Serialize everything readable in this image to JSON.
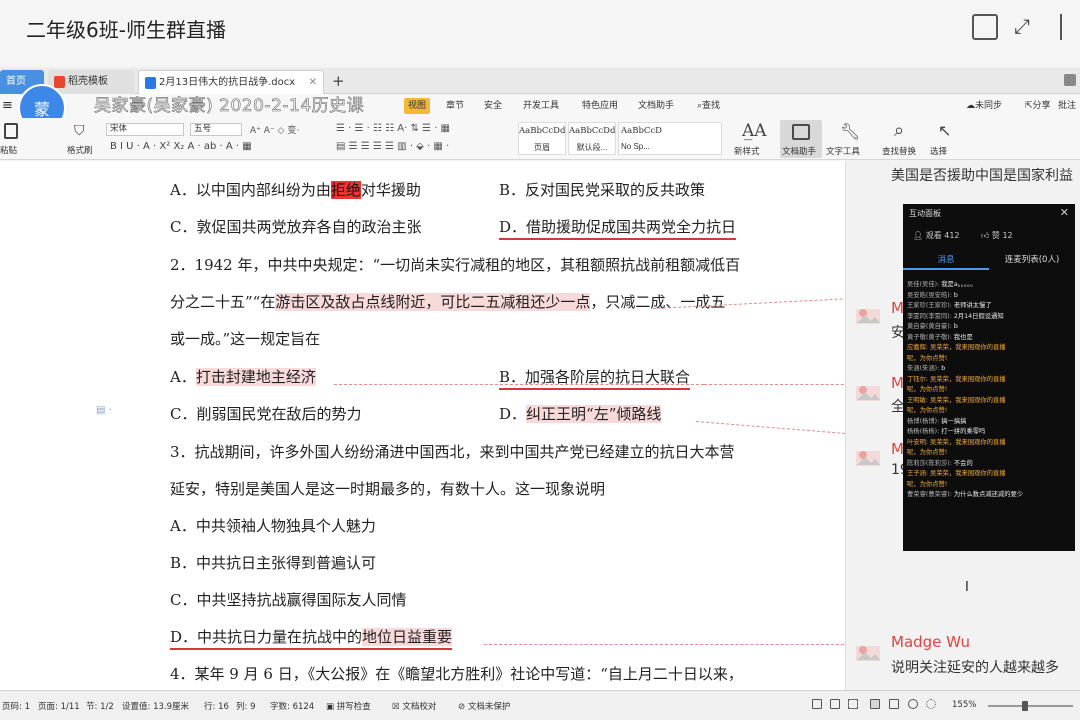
{
  "live": {
    "title": "二年级6班-师生群直播",
    "streamer_line": "吴家豪(吴家豪) 2020-2-14历史课"
  },
  "avatar": {
    "label": "蒙"
  },
  "tabs": [
    {
      "label": "首页"
    },
    {
      "label": "稻壳模板",
      "icon_color": "#e8462d"
    },
    {
      "label": "2月13日伟大的抗日战争.docx",
      "icon_color": "#2b78e4"
    }
  ],
  "menu": {
    "view": "视图",
    "chapter": "章节",
    "security": "安全",
    "dev": "开发工具",
    "special": "特色应用",
    "doc_helper": "文档助手",
    "search": "查找",
    "sync": "未同步",
    "share": "分享",
    "batch": "批注"
  },
  "ribbon": {
    "paste": "粘贴",
    "format_painter": "格式刷",
    "font_name": "宋体",
    "font_size": "五号",
    "styles": [
      {
        "sample": "AaBbCcDd",
        "label": "页眉"
      },
      {
        "sample": "AaBbCcDd",
        "label": "默认段..."
      },
      {
        "sample": "AaBbCcD",
        "label": "No Sp..."
      }
    ],
    "new_style": "新样式",
    "doc_helper": "文档助手",
    "text_tools": "文字工具",
    "find_replace": "查找替换",
    "select": "选择"
  },
  "doc": {
    "q1_a": "A．以中国内部纠纷为由",
    "q1_a_hl": "拒绝",
    "q1_a_end": "对华援助",
    "q1_b": "B．反对国民党采取的反共政策",
    "q1_c": "C．敦促国共两党放弃各自的政治主张",
    "q1_d": "D．借助援助促成国共两党全力抗日",
    "q2_l1": "2．1942 年，中共中央规定：“一切尚未实行减租的地区，其租额照抗战前租额减低百",
    "q2_l2_a": "分之二十五”“在",
    "q2_l2_hl": "游击区及敌占点线附近，可比二五减租还少一点",
    "q2_l2_b": "，只减二成、一成五",
    "q2_l3": "或一成。”这一规定旨在",
    "q2_a_pre": "A．",
    "q2_a": "打击封建地主经济",
    "q2_b": "B．加强各阶层的抗日大联合",
    "q2_c": "C．削弱国民党在敌后的势力",
    "q2_d_pre": "D．",
    "q2_d": "纠正王明“左”倾路线",
    "q3_l1": "3．抗战期间，许多外国人纷纷涌进中国西北，来到中国共产党已经建立的抗日大本营",
    "q3_l2": "延安，特别是美国人是这一时期最多的，有数十人。这一现象说明",
    "q3_a": "A．中共领袖人物独具个人魅力",
    "q3_b": "B．中共抗日主张得到普遍认可",
    "q3_c": "C．中共坚持抗战赢得国际友人同情",
    "q3_d_pre": "D．中共抗日力量在抗战中的",
    "q3_d_hl": "地位日益重要",
    "q4_l1": "4．某年 9 月 6 日，《大公报》在《瞻望北方胜利》社论中写道：“自上月二十日以来，"
  },
  "comments": [
    {
      "text": "美国是否援助中国是国家利益"
    },
    {
      "name": "M",
      "text": "安"
    },
    {
      "name": "M",
      "text": "全"
    },
    {
      "name": "M",
      "text": "19"
    },
    {
      "name": "Madge Wu",
      "text": "说明关注延安的人越来越多"
    }
  ],
  "board": {
    "title": "互动面板",
    "viewers": "观看 412",
    "likes": "赞 12",
    "tab_messages": "消息",
    "tab_mic": "连麦列表(0人)",
    "messages": [
      {
        "name": "吴佳(吴佳):",
        "text": "我是a。。。。。",
        "orange": false
      },
      {
        "name": "吴安皓(吴安皓):",
        "text": "b",
        "orange": false
      },
      {
        "name": "王家珍(王家珍):",
        "text": "老师讲太慢了",
        "orange": false
      },
      {
        "name": "李雯同(李雯同):",
        "text": "2月14日假设通知",
        "orange": false
      },
      {
        "name": "黄自豪(黄自豪):",
        "text": "b",
        "orange": false
      },
      {
        "name": "黄子敬(黄子敬):",
        "text": "我也是",
        "orange": false
      },
      {
        "name": "应嘉辉:",
        "text": "吴荣荣，我来围观你的直播",
        "orange": true
      },
      {
        "name": "",
        "text": "呢，为你点赞!",
        "orange": true
      },
      {
        "name": "朱涵(朱涵):",
        "text": "b",
        "orange": false
      },
      {
        "name": "丁钰尔:",
        "text": "吴荣荣，我来围观你的直播",
        "orange": true
      },
      {
        "name": "",
        "text": "呢，为你点赞!",
        "orange": true
      },
      {
        "name": "王明敏:",
        "text": "吴荣荣，我来围观你的直播",
        "orange": true
      },
      {
        "name": "",
        "text": "呢，为你点赞!",
        "orange": true
      },
      {
        "name": "杨博(杨博):",
        "text": "搞一搞搞",
        "orange": false
      },
      {
        "name": "杨杨(杨杨):",
        "text": "打一拼的乘零吗",
        "orange": false
      },
      {
        "name": "叶安明:",
        "text": "吴荣荣，我来围观你的直播",
        "orange": true
      },
      {
        "name": "",
        "text": "呢，为你点赞!",
        "orange": true
      },
      {
        "name": "陈莉莎(陈莉莎):",
        "text": "不会的",
        "orange": false
      },
      {
        "name": "王子涵:",
        "text": "吴荣荣，我来围观你的直播",
        "orange": true
      },
      {
        "name": "",
        "text": "呢，为你点赞!",
        "orange": true
      },
      {
        "name": "曹荣睿(曹荣睿):",
        "text": "为什么数点减还减的要少",
        "orange": false
      }
    ]
  },
  "status": {
    "page_num": "页码: 1",
    "pages": "页面: 1/11",
    "section": "节: 1/2",
    "set_value": "设置值: 13.9厘米",
    "row": "行: 16",
    "col": "列: 9",
    "words": "字数: 6124",
    "spell": "拼写检查",
    "proof": "文档校对",
    "unprotected": "文档未保护",
    "zoom": "155%"
  }
}
